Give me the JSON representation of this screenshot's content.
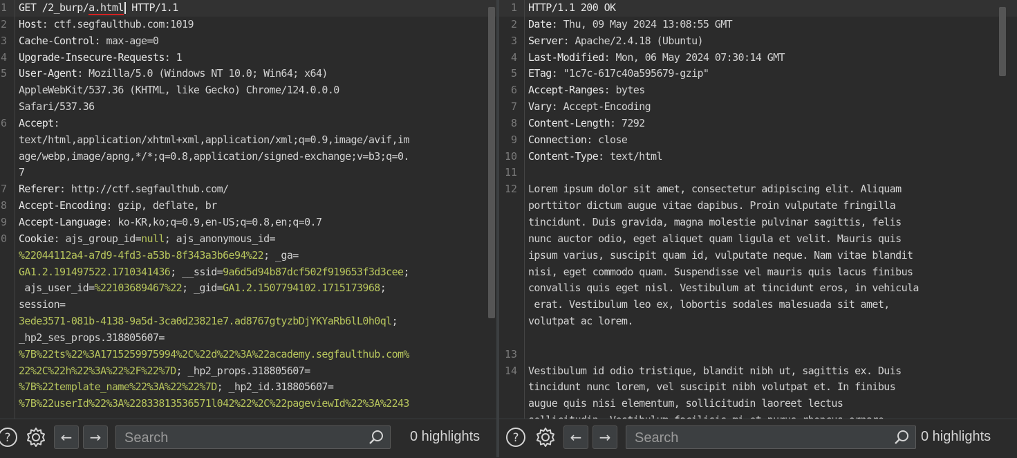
{
  "request": {
    "lines": [
      {
        "n": "1",
        "segs": [
          {
            "t": "GET /2_burp/",
            "c": "hname"
          },
          {
            "t": "a.html",
            "c": "hname redline"
          },
          {
            "caret": true
          },
          {
            "t": " HTTP/1.1",
            "c": "hname"
          }
        ],
        "cur": true
      },
      {
        "n": "2",
        "segs": [
          {
            "t": "Host",
            "c": "hname"
          },
          {
            "t": ": ctf.segfaulthub.com:1019",
            "c": "ckey"
          }
        ]
      },
      {
        "n": "3",
        "segs": [
          {
            "t": "Cache-Control",
            "c": "hname"
          },
          {
            "t": ": max-age=0",
            "c": "ckey"
          }
        ]
      },
      {
        "n": "4",
        "segs": [
          {
            "t": "Upgrade-Insecure-Requests",
            "c": "hname"
          },
          {
            "t": ": 1",
            "c": "ckey"
          }
        ]
      },
      {
        "n": "5",
        "segs": [
          {
            "t": "User-Agent",
            "c": "hname"
          },
          {
            "t": ": Mozilla/5.0 (Windows NT 10.0; Win64; x64)",
            "c": "ckey"
          }
        ]
      },
      {
        "n": "",
        "segs": [
          {
            "t": "AppleWebKit/537.36 (KHTML, like Gecko) Chrome/124.0.0.0",
            "c": "ckey"
          }
        ]
      },
      {
        "n": "",
        "segs": [
          {
            "t": "Safari/537.36",
            "c": "ckey"
          }
        ]
      },
      {
        "n": "6",
        "segs": [
          {
            "t": "Accept",
            "c": "hname"
          },
          {
            "t": ":",
            "c": "ckey"
          }
        ]
      },
      {
        "n": "",
        "segs": [
          {
            "t": "text/html,application/xhtml+xml,application/xml;q=0.9,image/avif,im",
            "c": "ckey"
          }
        ]
      },
      {
        "n": "",
        "segs": [
          {
            "t": "age/webp,image/apng,*/*;q=0.8,application/signed-exchange;v=b3;q=0.",
            "c": "ckey"
          }
        ]
      },
      {
        "n": "",
        "segs": [
          {
            "t": "7",
            "c": "ckey"
          }
        ]
      },
      {
        "n": "7",
        "segs": [
          {
            "t": "Referer",
            "c": "hname"
          },
          {
            "t": ": http://ctf.segfaulthub.com/",
            "c": "ckey"
          }
        ]
      },
      {
        "n": "8",
        "segs": [
          {
            "t": "Accept-Encoding",
            "c": "hname"
          },
          {
            "t": ": gzip, deflate, br",
            "c": "ckey"
          }
        ]
      },
      {
        "n": "9",
        "segs": [
          {
            "t": "Accept-Language",
            "c": "hname"
          },
          {
            "t": ": ko-KR,ko;q=0.9,en-US;q=0.8,en;q=0.7",
            "c": "ckey"
          }
        ]
      },
      {
        "n": "0",
        "segs": [
          {
            "t": "Cookie",
            "c": "hname"
          },
          {
            "t": ": ajs_group_id=",
            "c": "ckey"
          },
          {
            "t": "null",
            "c": "cval"
          },
          {
            "t": "; ajs_anonymous_id=",
            "c": "ckey"
          }
        ]
      },
      {
        "n": "",
        "segs": [
          {
            "t": "%22044112a4-a7d9-4fd3-a53b-8f343a3b6e94%22",
            "c": "cval"
          },
          {
            "t": "; _ga=",
            "c": "ckey"
          }
        ]
      },
      {
        "n": "",
        "segs": [
          {
            "t": "GA1.2.191497522.1710341436",
            "c": "cval"
          },
          {
            "t": "; __ssid=",
            "c": "ckey"
          },
          {
            "t": "9a6d5d94b87dcf502f919653f3d3cee",
            "c": "cval"
          },
          {
            "t": ";",
            "c": "ckey"
          }
        ]
      },
      {
        "n": "",
        "segs": [
          {
            "t": " ajs_user_id=",
            "c": "ckey"
          },
          {
            "t": "%22103689467%22",
            "c": "cval"
          },
          {
            "t": "; _gid=",
            "c": "ckey"
          },
          {
            "t": "GA1.2.1507794102.1715173968",
            "c": "cval"
          },
          {
            "t": ";",
            "c": "ckey"
          }
        ]
      },
      {
        "n": "",
        "segs": [
          {
            "t": "session=",
            "c": "ckey"
          }
        ]
      },
      {
        "n": "",
        "segs": [
          {
            "t": "3ede3571-081b-4138-9a5d-3ca0d23821e7.ad8767gtyzbDjYKYaRb6lL0h0ql",
            "c": "cval"
          },
          {
            "t": ";",
            "c": "ckey"
          }
        ]
      },
      {
        "n": "",
        "segs": [
          {
            "t": "_hp2_ses_props.318805607=",
            "c": "ckey"
          }
        ]
      },
      {
        "n": "",
        "segs": [
          {
            "t": "%7B%22ts%22%3A1715259975994%2C%22d%22%3A%22academy.segfaulthub.com%",
            "c": "cval"
          }
        ]
      },
      {
        "n": "",
        "segs": [
          {
            "t": "22%2C%22h%22%3A%22%2F%22%7D",
            "c": "cval"
          },
          {
            "t": "; _hp2_props.318805607=",
            "c": "ckey"
          }
        ]
      },
      {
        "n": "",
        "segs": [
          {
            "t": "%7B%22template_name%22%3A%22%22%7D",
            "c": "cval"
          },
          {
            "t": "; _hp2_id.318805607=",
            "c": "ckey"
          }
        ]
      },
      {
        "n": "",
        "segs": [
          {
            "t": "%7B%22userId%22%3A%22833813536571l042%22%2C%22pageviewId%22%3A%2243",
            "c": "cval"
          }
        ]
      }
    ]
  },
  "response": {
    "lines": [
      {
        "n": "1",
        "segs": [
          {
            "t": "HTTP/1.1 200 OK",
            "c": "hname"
          }
        ],
        "cur": true
      },
      {
        "n": "2",
        "segs": [
          {
            "t": "Date",
            "c": "hname"
          },
          {
            "t": ": Thu, 09 May 2024 13:08:55 GMT",
            "c": "ckey"
          }
        ]
      },
      {
        "n": "3",
        "segs": [
          {
            "t": "Server",
            "c": "hname"
          },
          {
            "t": ": Apache/2.4.18 (Ubuntu)",
            "c": "ckey"
          }
        ]
      },
      {
        "n": "4",
        "segs": [
          {
            "t": "Last-Modified",
            "c": "hname"
          },
          {
            "t": ": Mon, 06 May 2024 07:30:14 GMT",
            "c": "ckey"
          }
        ]
      },
      {
        "n": "5",
        "segs": [
          {
            "t": "ETag",
            "c": "hname"
          },
          {
            "t": ": \"1c7c-617c40a595679-gzip\"",
            "c": "ckey"
          }
        ]
      },
      {
        "n": "6",
        "segs": [
          {
            "t": "Accept-Ranges",
            "c": "hname"
          },
          {
            "t": ": bytes",
            "c": "ckey"
          }
        ]
      },
      {
        "n": "7",
        "segs": [
          {
            "t": "Vary",
            "c": "hname"
          },
          {
            "t": ": Accept-Encoding",
            "c": "ckey"
          }
        ]
      },
      {
        "n": "8",
        "segs": [
          {
            "t": "Content-Length",
            "c": "hname"
          },
          {
            "t": ": 7292",
            "c": "ckey"
          }
        ]
      },
      {
        "n": "9",
        "segs": [
          {
            "t": "Connection",
            "c": "hname"
          },
          {
            "t": ": close",
            "c": "ckey"
          }
        ]
      },
      {
        "n": "10",
        "segs": [
          {
            "t": "Content-Type",
            "c": "hname"
          },
          {
            "t": ": text/html",
            "c": "ckey"
          }
        ]
      },
      {
        "n": "11",
        "segs": []
      },
      {
        "n": "12",
        "segs": [
          {
            "t": "Lorem ipsum dolor sit amet, consectetur adipiscing elit. Aliquam",
            "c": "ckey"
          }
        ]
      },
      {
        "n": "",
        "segs": [
          {
            "t": "porttitor dictum augue vitae dapibus. Proin vulputate fringilla",
            "c": "ckey"
          }
        ]
      },
      {
        "n": "",
        "segs": [
          {
            "t": "tincidunt. Duis gravida, magna molestie pulvinar sagittis, felis",
            "c": "ckey"
          }
        ]
      },
      {
        "n": "",
        "segs": [
          {
            "t": "nunc auctor odio, eget aliquet quam ligula et velit. Mauris quis",
            "c": "ckey"
          }
        ]
      },
      {
        "n": "",
        "segs": [
          {
            "t": "ipsum varius, suscipit quam id, vulputate neque. Nam vitae blandit",
            "c": "ckey"
          }
        ]
      },
      {
        "n": "",
        "segs": [
          {
            "t": "nisi, eget commodo quam. Suspendisse vel mauris quis lacus finibus",
            "c": "ckey"
          }
        ]
      },
      {
        "n": "",
        "segs": [
          {
            "t": "convallis quis eget nisl. Vestibulum at tincidunt eros, in vehicula",
            "c": "ckey"
          }
        ]
      },
      {
        "n": "",
        "segs": [
          {
            "t": " erat. Vestibulum leo ex, lobortis sodales malesuada sit amet,",
            "c": "ckey"
          }
        ]
      },
      {
        "n": "",
        "segs": [
          {
            "t": "volutpat ac lorem.",
            "c": "ckey"
          }
        ]
      },
      {
        "n": "",
        "segs": []
      },
      {
        "n": "13",
        "segs": []
      },
      {
        "n": "14",
        "segs": [
          {
            "t": "Vestibulum id odio tristique, blandit nibh ut, sagittis ex. Duis",
            "c": "ckey"
          }
        ]
      },
      {
        "n": "",
        "segs": [
          {
            "t": "tincidunt nunc lorem, vel suscipit nibh volutpat et. In finibus",
            "c": "ckey"
          }
        ]
      },
      {
        "n": "",
        "segs": [
          {
            "t": "augue quis nisi elementum, sollicitudin laoreet lectus",
            "c": "ckey"
          }
        ]
      },
      {
        "n": "",
        "segs": [
          {
            "t": "sollicitudin. Vestibulum facilisis mi et purus rhoncus ornare.",
            "c": "ckey"
          }
        ]
      }
    ]
  },
  "left_bar": {
    "search_placeholder": "Search",
    "highlights": "0 highlights"
  },
  "right_bar": {
    "search_placeholder": "Search",
    "highlights": "0 highlights"
  },
  "icons": [
    "help-icon",
    "settings-icon",
    "arrow-left-icon",
    "arrow-right-icon",
    "search-icon"
  ],
  "colors": {
    "accent": "#e8703a",
    "cookie_value": "#b7c55c",
    "underline": "#d32222"
  }
}
